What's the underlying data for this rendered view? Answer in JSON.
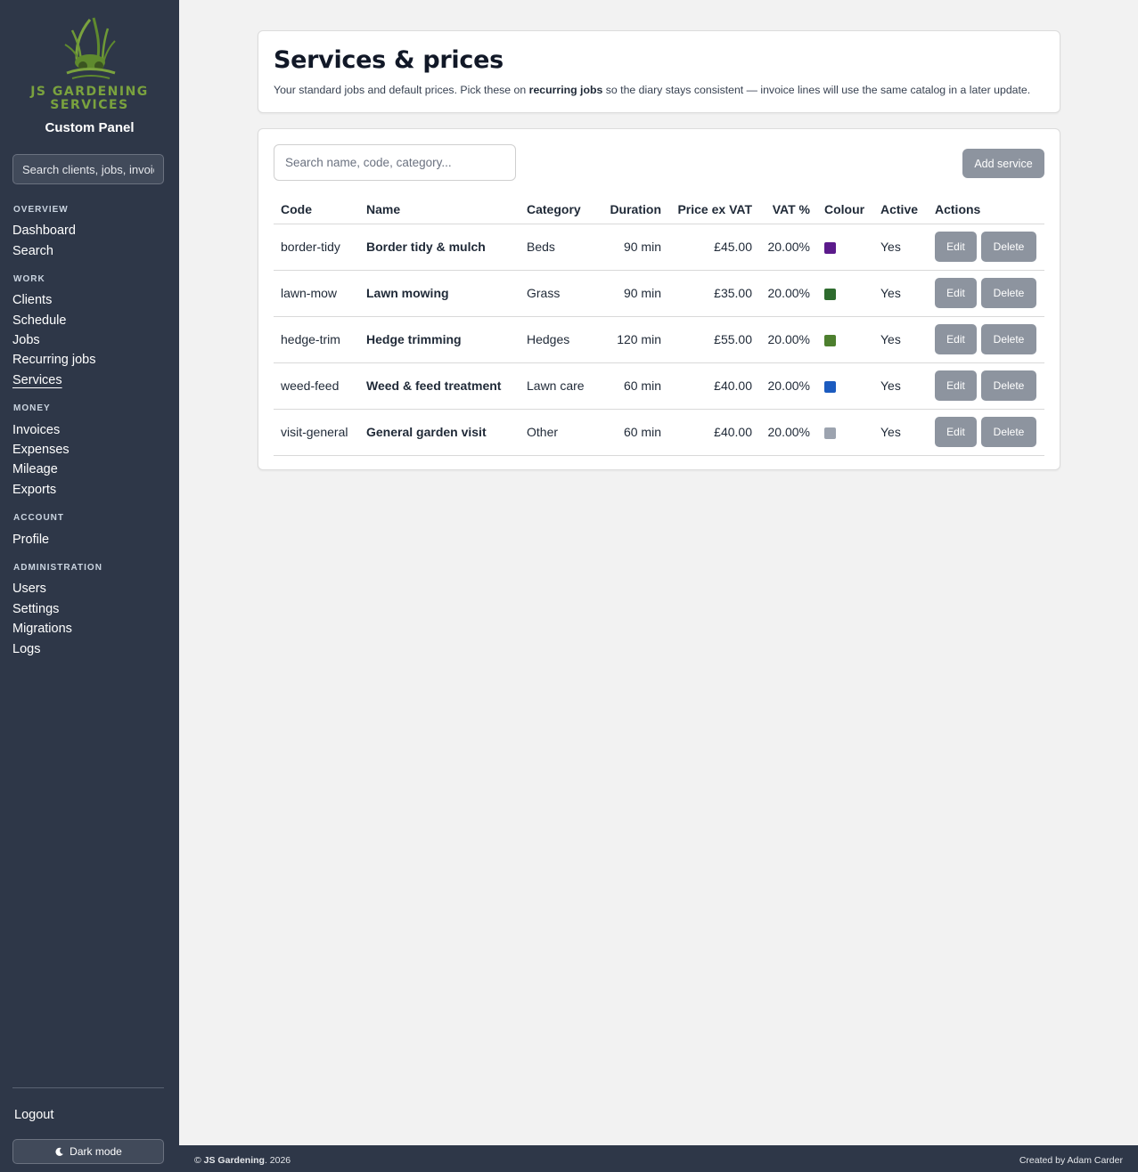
{
  "sidebar": {
    "brand": "JS GARDENING SERVICES",
    "panel_title": "Custom Panel",
    "search_placeholder": "Search clients, jobs, invoices",
    "sections": {
      "overview": "OVERVIEW",
      "work": "WORK",
      "money": "MONEY",
      "account": "ACCOUNT",
      "administration": "ADMINISTRATION"
    },
    "items": {
      "dashboard": "Dashboard",
      "search": "Search",
      "clients": "Clients",
      "schedule": "Schedule",
      "jobs": "Jobs",
      "recurring_jobs": "Recurring jobs",
      "services": "Services",
      "invoices": "Invoices",
      "expenses": "Expenses",
      "mileage": "Mileage",
      "exports": "Exports",
      "profile": "Profile",
      "users": "Users",
      "settings": "Settings",
      "migrations": "Migrations",
      "logs": "Logs"
    },
    "active_item": "Services",
    "logout": "Logout",
    "dark_mode": "Dark mode"
  },
  "header": {
    "title": "Services & prices",
    "subtitle_pre": "Your standard jobs and default prices. Pick these on ",
    "subtitle_bold": "recurring jobs",
    "subtitle_post": " so the diary stays consistent — invoice lines will use the same catalog in a later update."
  },
  "toolbar": {
    "search_placeholder": "Search name, code, category...",
    "add_label": "Add service"
  },
  "table": {
    "columns": {
      "code": "Code",
      "name": "Name",
      "category": "Category",
      "duration": "Duration",
      "price": "Price ex VAT",
      "vat": "VAT %",
      "colour": "Colour",
      "active": "Active",
      "actions": "Actions"
    },
    "edit_label": "Edit",
    "delete_label": "Delete",
    "rows": [
      {
        "code": "border-tidy",
        "name": "Border tidy & mulch",
        "category": "Beds",
        "duration": "90 min",
        "price": "£45.00",
        "vat": "20.00%",
        "colour": "#5b1a8b",
        "active": "Yes"
      },
      {
        "code": "lawn-mow",
        "name": "Lawn mowing",
        "category": "Grass",
        "duration": "90 min",
        "price": "£35.00",
        "vat": "20.00%",
        "colour": "#2e6b2e",
        "active": "Yes"
      },
      {
        "code": "hedge-trim",
        "name": "Hedge trimming",
        "category": "Hedges",
        "duration": "120 min",
        "price": "£55.00",
        "vat": "20.00%",
        "colour": "#4d7f2e",
        "active": "Yes"
      },
      {
        "code": "weed-feed",
        "name": "Weed & feed treatment",
        "category": "Lawn care",
        "duration": "60 min",
        "price": "£40.00",
        "vat": "20.00%",
        "colour": "#1c5bbf",
        "active": "Yes"
      },
      {
        "code": "visit-general",
        "name": "General garden visit",
        "category": "Other",
        "duration": "60 min",
        "price": "£40.00",
        "vat": "20.00%",
        "colour": "#9ca3af",
        "active": "Yes"
      }
    ]
  },
  "footer": {
    "copyright_symbol": "©",
    "company": "JS Gardening",
    "year": ". 2026",
    "credit": "Created by Adam Carder"
  },
  "colors": {
    "sidebar_bg": "#2e3748",
    "brand_green": "#7aa23e",
    "button_gray": "#8d949f"
  }
}
